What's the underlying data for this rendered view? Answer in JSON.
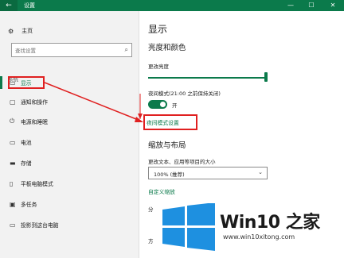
{
  "window": {
    "title": "设置",
    "back_icon": "←",
    "minimize": "—",
    "maximize": "☐",
    "close": "✕",
    "accent": "#0b7a4b"
  },
  "nav": {
    "home_label": "主页",
    "search_placeholder": "查找设置",
    "section_label": "系统",
    "items": [
      {
        "label": "显示",
        "icon": "monitor-icon",
        "glyph": "▭",
        "active": true
      },
      {
        "label": "通知和操作",
        "icon": "notification-icon",
        "glyph": "▢"
      },
      {
        "label": "电源和睡眠",
        "icon": "power-icon",
        "glyph": "⏻"
      },
      {
        "label": "电池",
        "icon": "battery-icon",
        "glyph": "▭"
      },
      {
        "label": "存储",
        "icon": "storage-icon",
        "glyph": "▬"
      },
      {
        "label": "平板电脑模式",
        "icon": "tablet-icon",
        "glyph": "▯"
      },
      {
        "label": "多任务",
        "icon": "multitask-icon",
        "glyph": "▣"
      },
      {
        "label": "投影到这台电脑",
        "icon": "project-icon",
        "glyph": "▭"
      }
    ]
  },
  "main": {
    "page_title": "显示",
    "brightness_heading": "亮度和颜色",
    "brightness_label": "更改亮度",
    "brightness_level": 1.0,
    "night_light_label": "夜间模式(21:00 之前保持关闭)",
    "night_light_state": "开",
    "night_light_on": true,
    "night_light_link": "夜间模式设置",
    "scale_heading": "缩放与布局",
    "scale_label": "更改文本、应用等项目的大小",
    "scale_value": "100% (推荐)",
    "custom_scale_link": "自定义缩放",
    "partial_label_1": "分",
    "partial_label_2": "方"
  },
  "watermark": {
    "brand": "Win10 之家",
    "url": "www.win10xitong.com",
    "logo_color": "#1e90e0"
  }
}
